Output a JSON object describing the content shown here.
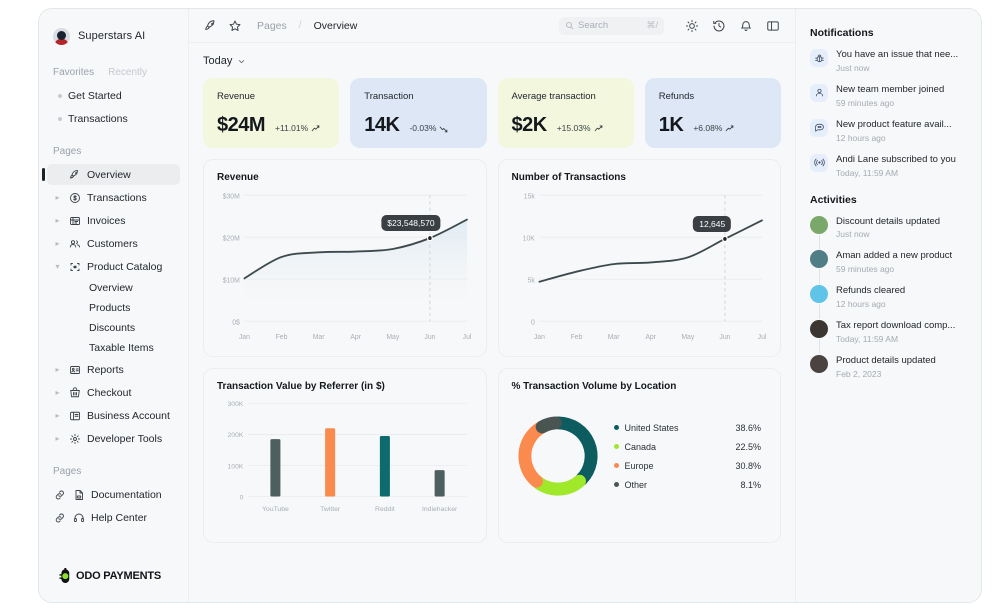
{
  "brand": {
    "name": "Superstars AI"
  },
  "sidebar": {
    "tabs": [
      {
        "label": "Favorites",
        "active": true
      },
      {
        "label": "Recently",
        "active": false
      }
    ],
    "favorites": [
      {
        "label": "Get Started"
      },
      {
        "label": "Transactions"
      }
    ],
    "pages_label": "Pages",
    "pages": [
      {
        "label": "Overview",
        "icon": "rocket-icon",
        "active": true,
        "expandable": false
      },
      {
        "label": "Transactions",
        "icon": "dollar-circle-icon",
        "active": false,
        "expandable": true
      },
      {
        "label": "Invoices",
        "icon": "invoice-icon",
        "active": false,
        "expandable": true
      },
      {
        "label": "Customers",
        "icon": "customers-icon",
        "active": false,
        "expandable": true
      },
      {
        "label": "Product Catalog",
        "icon": "catalog-icon",
        "active": false,
        "expandable": true,
        "expanded": true
      }
    ],
    "catalog_children": [
      {
        "label": "Overview"
      },
      {
        "label": "Products"
      },
      {
        "label": "Discounts"
      },
      {
        "label": "Taxable Items"
      }
    ],
    "pages_after": [
      {
        "label": "Reports",
        "icon": "report-icon",
        "expandable": true
      },
      {
        "label": "Checkout",
        "icon": "cart-icon",
        "expandable": true
      },
      {
        "label": "Business Account",
        "icon": "account-icon",
        "expandable": true
      },
      {
        "label": "Developer Tools",
        "icon": "gear-icon",
        "expandable": true
      }
    ],
    "bottom_label": "Pages",
    "bottom_links": [
      {
        "label": "Documentation",
        "icon": "doc-icon"
      },
      {
        "label": "Help Center",
        "icon": "headset-icon"
      }
    ],
    "footer_logo": "ODO PAYMENTS"
  },
  "topbar": {
    "rocket_icon": "rocket-icon",
    "star_icon": "star-icon",
    "breadcrumb_root": "Pages",
    "breadcrumb_sep": "/",
    "breadcrumb_current": "Overview",
    "search_placeholder": "Search",
    "search_shortcut": "⌘/",
    "icons": [
      "sun-icon",
      "history-icon",
      "bell-icon",
      "panel-icon"
    ]
  },
  "main": {
    "period_label": "Today",
    "kpis": [
      {
        "label": "Revenue",
        "value": "$24M",
        "delta": "+11.01%",
        "trend": "up",
        "bg": "#f3f7dd"
      },
      {
        "label": "Transaction",
        "value": "14K",
        "delta": "-0.03%",
        "trend": "down",
        "bg": "#dde7f5"
      },
      {
        "label": "Average transaction",
        "value": "$2K",
        "delta": "+15.03%",
        "trend": "up",
        "bg": "#f3f7dd"
      },
      {
        "label": "Refunds",
        "value": "1K",
        "delta": "+6.08%",
        "trend": "up",
        "bg": "#dde7f5"
      }
    ]
  },
  "chart_data": [
    {
      "type": "line",
      "title": "Revenue",
      "xlabel": "",
      "ylabel": "",
      "x": [
        "Jan",
        "Feb",
        "Mar",
        "Apr",
        "May",
        "Jun",
        "Jul"
      ],
      "values": [
        10.2,
        15.3,
        16.4,
        16.6,
        17.2,
        19.8,
        24.2
      ],
      "ytick_labels": [
        "$30M",
        "$20M",
        "$10M",
        "0$"
      ],
      "ytick_values": [
        30,
        20,
        10,
        0
      ],
      "ylim": [
        0,
        30
      ],
      "grid": true,
      "annotation": {
        "label": "$23,548,570",
        "x": "Jun",
        "y": 19.8
      },
      "line_color": "#3d4a4d",
      "area_fill": "#e8f0f5"
    },
    {
      "type": "line",
      "title": "Number of Transactions",
      "xlabel": "",
      "ylabel": "",
      "x": [
        "Jan",
        "Feb",
        "Mar",
        "Apr",
        "May",
        "Jun",
        "Jul"
      ],
      "values": [
        4700,
        5900,
        6800,
        7000,
        7600,
        9800,
        12000
      ],
      "ytick_labels": [
        "15k",
        "10K",
        "5k",
        "0"
      ],
      "ytick_values": [
        15000,
        10000,
        5000,
        0
      ],
      "ylim": [
        0,
        15000
      ],
      "grid": true,
      "annotation": {
        "label": "12,645",
        "x": "Jun",
        "y": 9800
      },
      "line_color": "#3d4a4d"
    },
    {
      "type": "bar",
      "title": "Transaction Value by Referrer (in $)",
      "categories": [
        "YouTube",
        "Twitter",
        "Reddit",
        "Indiehacker"
      ],
      "values": [
        185000,
        220000,
        195000,
        85000
      ],
      "colors": [
        "#4e5f60",
        "#fb8a4e",
        "#0d6b6e",
        "#4e5f60"
      ],
      "ytick_labels": [
        "300K",
        "200K",
        "100K",
        "0"
      ],
      "ytick_values": [
        300000,
        200000,
        100000,
        0
      ],
      "ylim": [
        0,
        300000
      ],
      "grid": true
    },
    {
      "type": "pie",
      "title": "% Transaction Volume by Location",
      "labels": [
        "United States",
        "Canada",
        "Europe",
        "Other"
      ],
      "values": [
        38.6,
        22.5,
        30.8,
        8.1
      ],
      "value_labels": [
        "38.6%",
        "22.5%",
        "30.8%",
        "8.1%"
      ],
      "colors": [
        "#0d5c5f",
        "#9fe82a",
        "#fb8a4e",
        "#4a5552"
      ],
      "legend_position": "right",
      "donut": true
    }
  ],
  "notifications": {
    "title": "Notifications",
    "items": [
      {
        "icon": "bug-icon",
        "text": "You have an issue that nee...",
        "time": "Just now"
      },
      {
        "icon": "user-icon",
        "text": "New team member joined",
        "time": "59 minutes ago"
      },
      {
        "icon": "chat-icon",
        "text": "New product feature avail...",
        "time": "12 hours ago"
      },
      {
        "icon": "broadcast-icon",
        "text": "Andi Lane subscribed to you",
        "time": "Today, 11:59 AM"
      }
    ]
  },
  "activities": {
    "title": "Activities",
    "items": [
      {
        "text": "Discount details updated",
        "time": "Just now",
        "avatar": "#7aa86a"
      },
      {
        "text": "Aman added a new product",
        "time": "59 minutes ago",
        "avatar": "#4f7e86"
      },
      {
        "text": "Refunds cleared",
        "time": "12 hours ago",
        "avatar": "#5fc4e8"
      },
      {
        "text": "Tax report download comp...",
        "time": "Today, 11:59 AM",
        "avatar": "#3c3632"
      },
      {
        "text": "Product details updated",
        "time": "Feb 2, 2023",
        "avatar": "#4a4340"
      }
    ]
  }
}
